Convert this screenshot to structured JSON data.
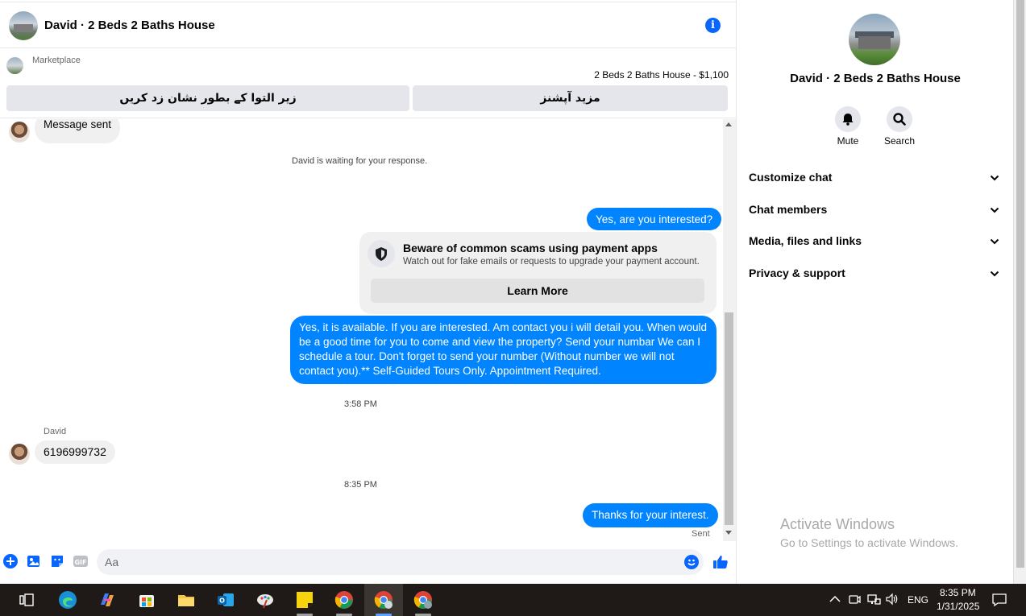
{
  "header": {
    "title": "David · 2 Beds 2 Baths House"
  },
  "marketplace": {
    "label": "Marketplace",
    "price_line": "2 Beds 2 Baths House - $1,100",
    "btn_mark": "زیر التوا کے بطور نشان زد کریں",
    "btn_more": "مزید آپشنز"
  },
  "messages": {
    "msg_sent": "Message sent",
    "waiting": "David is waiting for your response.",
    "out1": "Yes, are you interested?",
    "warning": {
      "title": "Beware of common scams using payment apps",
      "subtitle": "Watch out for fake emails or requests to upgrade your payment account.",
      "button": "Learn More"
    },
    "out2": "Yes, it is available. If you are interested.  Am contact you i will detail you.  When would be a good time for you to come and view the property? Send your numbar We can I schedule a tour.  Don't forget to send your number (Without number we will not contact you).** Self-Guided Tours Only. Appointment Required.",
    "time1": "3:58 PM",
    "sender": "David",
    "in_phone": "6196999732",
    "time2": "8:35 PM",
    "out3": "Thanks for your interest.",
    "status": "Sent"
  },
  "composer": {
    "placeholder": "Aa"
  },
  "panel": {
    "title": "David · 2 Beds 2 Baths House",
    "mute": "Mute",
    "search": "Search",
    "sections": [
      "Customize chat",
      "Chat members",
      "Media, files and links",
      "Privacy & support"
    ]
  },
  "watermark": {
    "line1": "Activate Windows",
    "line2": "Go to Settings to activate Windows."
  },
  "taskbar": {
    "lang": "ENG",
    "time": "8:35 PM",
    "date": "1/31/2025"
  },
  "colors": {
    "accent": "#0866ff",
    "bubble_out": "#0084ff",
    "bubble_in": "#f0f0f0"
  }
}
